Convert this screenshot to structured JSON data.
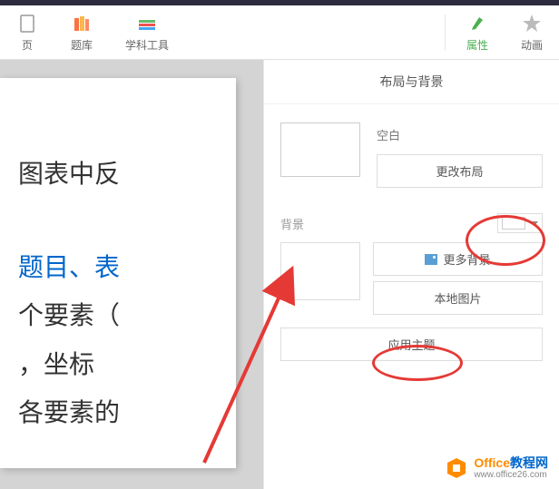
{
  "toolbar": {
    "items": [
      {
        "label": "页",
        "icon": "page"
      },
      {
        "label": "题库",
        "icon": "books"
      },
      {
        "label": "学科工具",
        "icon": "books2"
      },
      {
        "label": "属性",
        "icon": "brush",
        "active": true
      },
      {
        "label": "动画",
        "icon": "star"
      }
    ]
  },
  "slide": {
    "line1a": "图表中反",
    "blue1": "题目",
    "sep1": "、",
    "blue2": "表",
    "line3": "个要素（",
    "line4": "，坐标",
    "line5": "各要素的"
  },
  "panel": {
    "title": "布局与背景",
    "layout": {
      "label": "空白",
      "change_btn": "更改布局"
    },
    "background": {
      "label": "背景",
      "more_btn": "更多背景",
      "local_btn": "本地图片",
      "apply_btn": "应用主题"
    }
  },
  "watermark": {
    "brand_en": "Office",
    "brand_cn": "教程网",
    "url": "www.office26.com"
  }
}
